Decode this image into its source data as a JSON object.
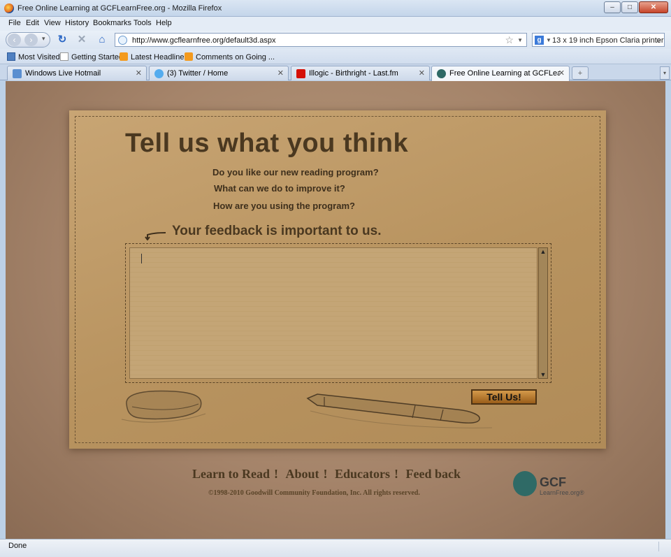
{
  "window": {
    "title": "Free Online Learning at GCFLearnFree.org - Mozilla Firefox",
    "minimize": "–",
    "maximize": "□",
    "close": "✕"
  },
  "menu": {
    "items": [
      "File",
      "Edit",
      "View",
      "History",
      "Bookmarks",
      "Tools",
      "Help"
    ],
    "access_keys": [
      "F",
      "E",
      "V",
      "s",
      "B",
      "T",
      "H"
    ]
  },
  "nav": {
    "url": "http://www.gcflearnfree.org/default3d.aspx",
    "search_query": "13 x 19 inch Epson Claria printer",
    "search_engine_icon": "google-icon"
  },
  "bookmarks": [
    {
      "label": "Most Visited",
      "icon": "most-visited-icon"
    },
    {
      "label": "Getting Started",
      "icon": "page-icon"
    },
    {
      "label": "Latest Headlines",
      "icon": "rss-icon"
    },
    {
      "label": "Comments on Going ...",
      "icon": "rss-icon"
    }
  ],
  "tabs": [
    {
      "label": "Windows Live Hotmail",
      "icon": "hotmail-icon",
      "color": "#5b8fd0",
      "active": false
    },
    {
      "label": "(3) Twitter / Home",
      "icon": "twitter-icon",
      "color": "#55acee",
      "active": false
    },
    {
      "label": "Illogic - Birthright - Last.fm",
      "icon": "lastfm-icon",
      "color": "#d51007",
      "active": false
    },
    {
      "label": "Free Online Learning at GCFLearn...",
      "icon": "gcf-icon",
      "color": "#2f6a66",
      "active": true
    }
  ],
  "page": {
    "headline": "Tell us what you think",
    "questions": [
      "Do you like our new reading program?",
      "What can we do to improve it?",
      "How are you using the program?"
    ],
    "feedback_title": "Your feedback is important to us.",
    "feedback_text": "",
    "submit_label": "Tell Us!",
    "footer_links": [
      "Learn to Read",
      "About",
      "Educators",
      "Feed back"
    ],
    "footer_separator": "!",
    "copyright": "©1998-2010 Goodwill Community Foundation, Inc. All rights reserved.",
    "logo_name": "GCF",
    "logo_sub": "LearnFree.org®"
  },
  "status": {
    "text": "Done"
  },
  "colors": {
    "background_brown": "#a5846a",
    "paper": "#b8935f",
    "headline": "#4a3820",
    "button": "#c48a3a"
  }
}
